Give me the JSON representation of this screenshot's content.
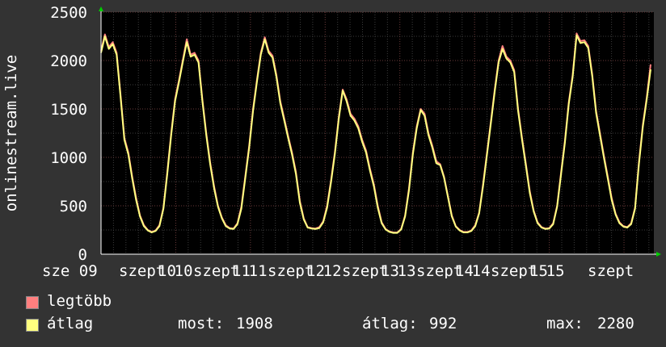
{
  "chart_data": {
    "type": "line",
    "ylabel": "onlinestream.live",
    "xlabel": "",
    "ylim": [
      0,
      2500
    ],
    "y_ticks": [
      "0",
      "500",
      "1000",
      "1500",
      "2000",
      "2500"
    ],
    "x_tick_labels": [
      "sze 09",
      "szept 10",
      "szept 11",
      "szept 12",
      "szept 13",
      "szept 14",
      "szept 15",
      "szept"
    ],
    "series": [
      {
        "name": "legtöbb",
        "color": "#ff7f7f",
        "values": [
          2100,
          2270,
          2140,
          2190,
          2080,
          1650,
          1200,
          1050,
          800,
          580,
          400,
          300,
          250,
          230,
          245,
          300,
          480,
          850,
          1250,
          1600,
          1800,
          2010,
          2220,
          2060,
          2080,
          2000,
          1600,
          1250,
          950,
          700,
          500,
          380,
          300,
          270,
          265,
          320,
          490,
          800,
          1120,
          1500,
          1800,
          2080,
          2240,
          2100,
          2050,
          1850,
          1580,
          1400,
          1220,
          1050,
          850,
          550,
          370,
          280,
          270,
          265,
          280,
          340,
          500,
          760,
          1060,
          1420,
          1700,
          1600,
          1450,
          1400,
          1320,
          1180,
          1070,
          880,
          720,
          500,
          330,
          260,
          235,
          225,
          225,
          260,
          400,
          680,
          1050,
          1320,
          1500,
          1450,
          1250,
          1120,
          960,
          930,
          800,
          600,
          400,
          290,
          250,
          230,
          230,
          245,
          300,
          430,
          720,
          1040,
          1370,
          1700,
          2000,
          2150,
          2040,
          2000,
          1900,
          1500,
          1200,
          930,
          650,
          450,
          330,
          280,
          265,
          270,
          320,
          500,
          840,
          1170,
          1570,
          1850,
          2280,
          2200,
          2210,
          2150,
          1860,
          1480,
          1250,
          1020,
          800,
          580,
          420,
          330,
          290,
          280,
          320,
          480,
          950,
          1340,
          1620,
          1960
        ]
      },
      {
        "name": "átlag",
        "color": "#ffff7f",
        "values": [
          2080,
          2250,
          2120,
          2170,
          2060,
          1630,
          1180,
          1030,
          780,
          560,
          390,
          290,
          245,
          225,
          240,
          290,
          470,
          830,
          1230,
          1580,
          1780,
          1990,
          2190,
          2040,
          2060,
          1980,
          1580,
          1230,
          930,
          680,
          490,
          370,
          290,
          265,
          260,
          310,
          470,
          780,
          1100,
          1480,
          1780,
          2060,
          2220,
          2080,
          2030,
          1830,
          1560,
          1380,
          1200,
          1030,
          830,
          530,
          360,
          275,
          265,
          260,
          270,
          330,
          480,
          740,
          1040,
          1400,
          1690,
          1580,
          1430,
          1380,
          1300,
          1160,
          1050,
          860,
          700,
          480,
          320,
          255,
          230,
          220,
          220,
          255,
          390,
          660,
          1030,
          1300,
          1490,
          1430,
          1230,
          1100,
          940,
          920,
          790,
          590,
          390,
          285,
          245,
          225,
          225,
          240,
          290,
          420,
          700,
          1020,
          1350,
          1680,
          1980,
          2120,
          2020,
          1980,
          1880,
          1480,
          1180,
          910,
          630,
          440,
          320,
          275,
          260,
          265,
          310,
          490,
          820,
          1150,
          1550,
          1830,
          2260,
          2180,
          2190,
          2130,
          1840,
          1460,
          1230,
          1000,
          780,
          560,
          410,
          320,
          285,
          275,
          310,
          470,
          930,
          1320,
          1600,
          1908
        ]
      }
    ],
    "stats": {
      "now_label": "most:",
      "now": "1908",
      "avg_label": "átlag:",
      "avg": "992",
      "max_label": "max:",
      "max": "2280"
    }
  }
}
